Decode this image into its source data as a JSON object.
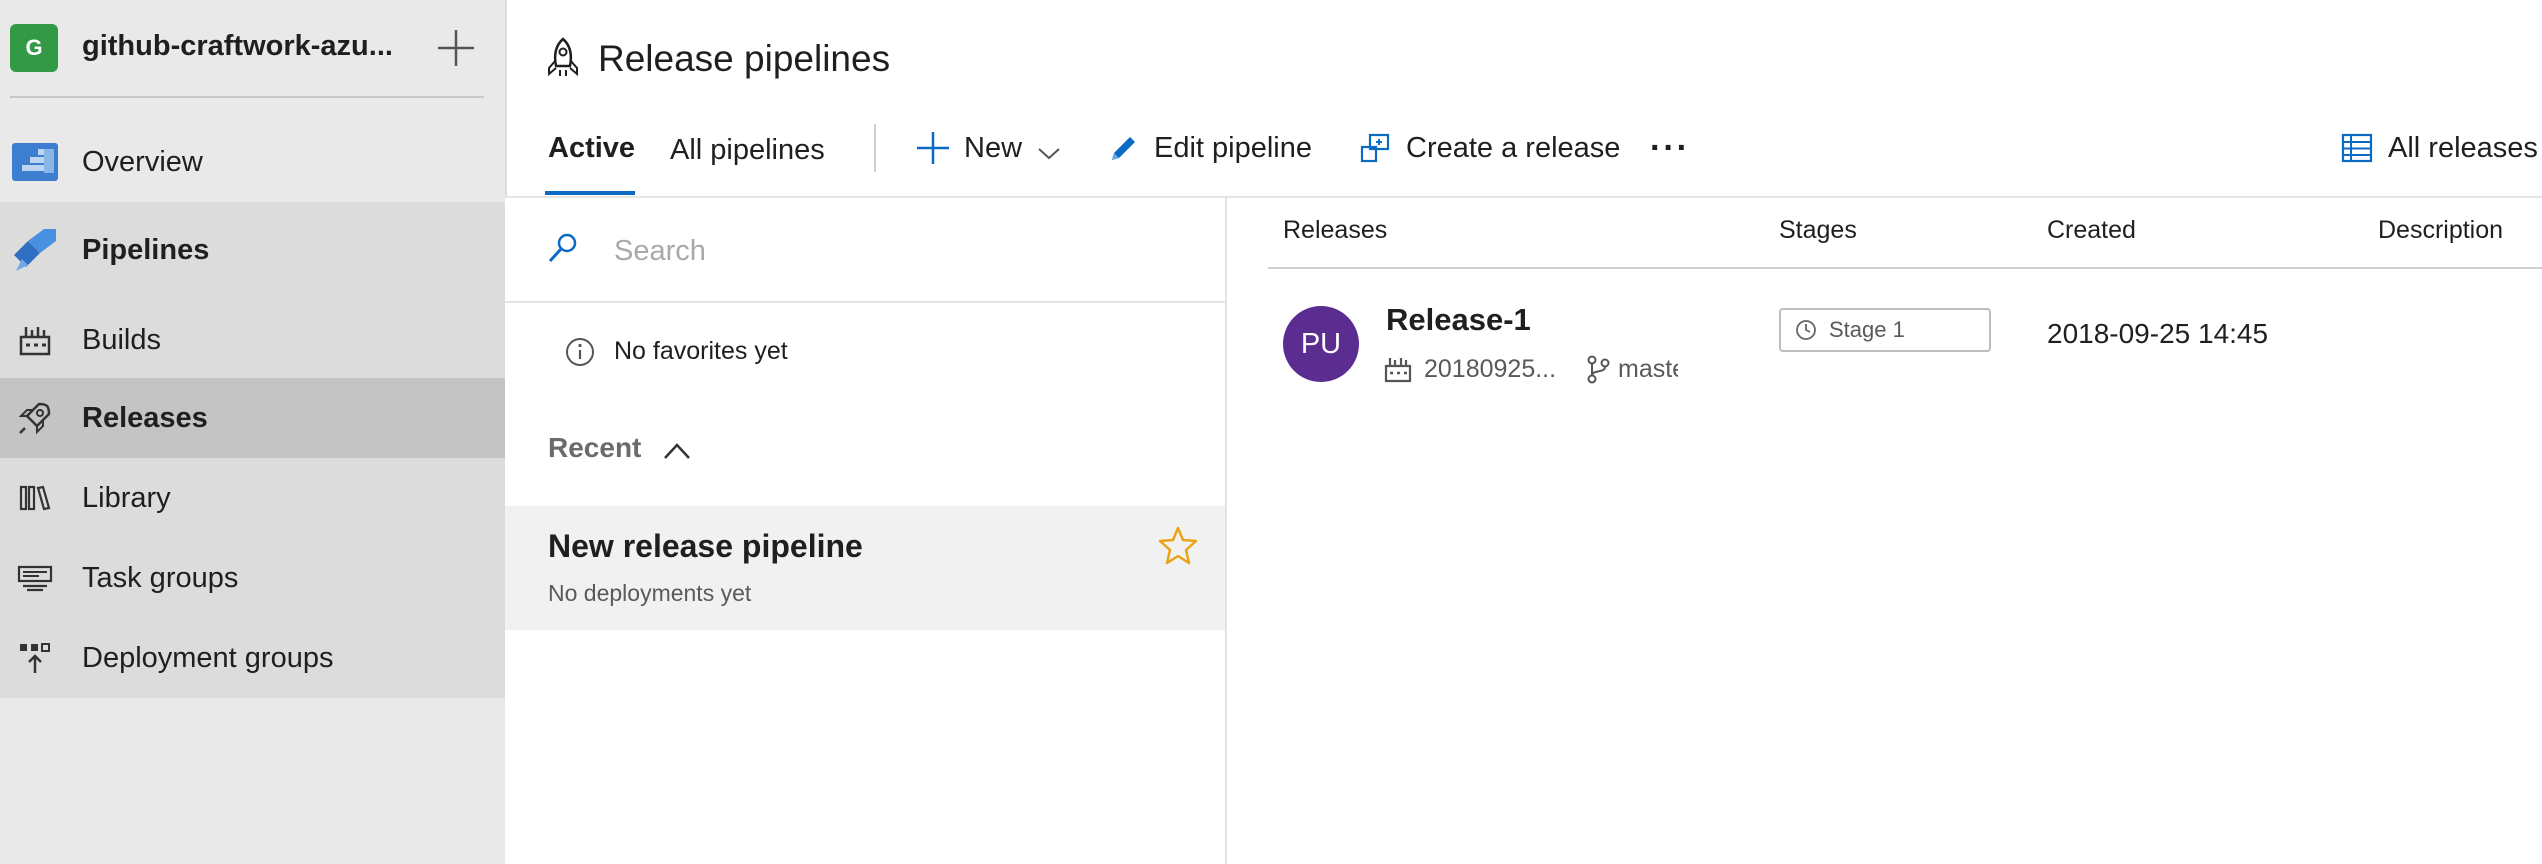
{
  "sidebar": {
    "project_initial": "G",
    "project_name": "github-craftwork-azu...",
    "items": [
      {
        "label": "Overview",
        "icon": "overview-icon"
      },
      {
        "label": "Pipelines",
        "icon": "pipelines-icon"
      },
      {
        "label": "Builds",
        "icon": "builds-icon"
      },
      {
        "label": "Releases",
        "icon": "releases-icon",
        "selected": true
      },
      {
        "label": "Library",
        "icon": "library-icon"
      },
      {
        "label": "Task groups",
        "icon": "task-groups-icon"
      },
      {
        "label": "Deployment groups",
        "icon": "deployment-groups-icon"
      }
    ]
  },
  "header": {
    "title": "Release pipelines",
    "tabs": [
      {
        "label": "Active",
        "selected": true
      },
      {
        "label": "All pipelines",
        "selected": false
      }
    ],
    "toolbar": {
      "new_label": "New",
      "edit_label": "Edit pipeline",
      "create_label": "Create a release",
      "more_label": "···",
      "all_releases_label": "All releases"
    }
  },
  "list": {
    "search_placeholder": "Search",
    "no_favorites": "No favorites yet",
    "recent_label": "Recent",
    "pipelines": [
      {
        "name": "New release pipeline",
        "status": "No deployments yet"
      }
    ]
  },
  "releases": {
    "columns": [
      "Releases",
      "Stages",
      "Created",
      "Description"
    ],
    "rows": [
      {
        "avatar_initials": "PU",
        "name": "Release-1",
        "build": "20180925...",
        "branch": "master",
        "stage": "Stage 1",
        "created": "2018-09-25 14:45"
      }
    ]
  },
  "colors": {
    "accent": "#0b6bc4",
    "project_avatar": "#339947",
    "release_avatar": "#5c2d91",
    "star": "#e8a317",
    "sidebar_bg": "#e9e9e9",
    "sidebar_selected": "#c4c4c4"
  }
}
